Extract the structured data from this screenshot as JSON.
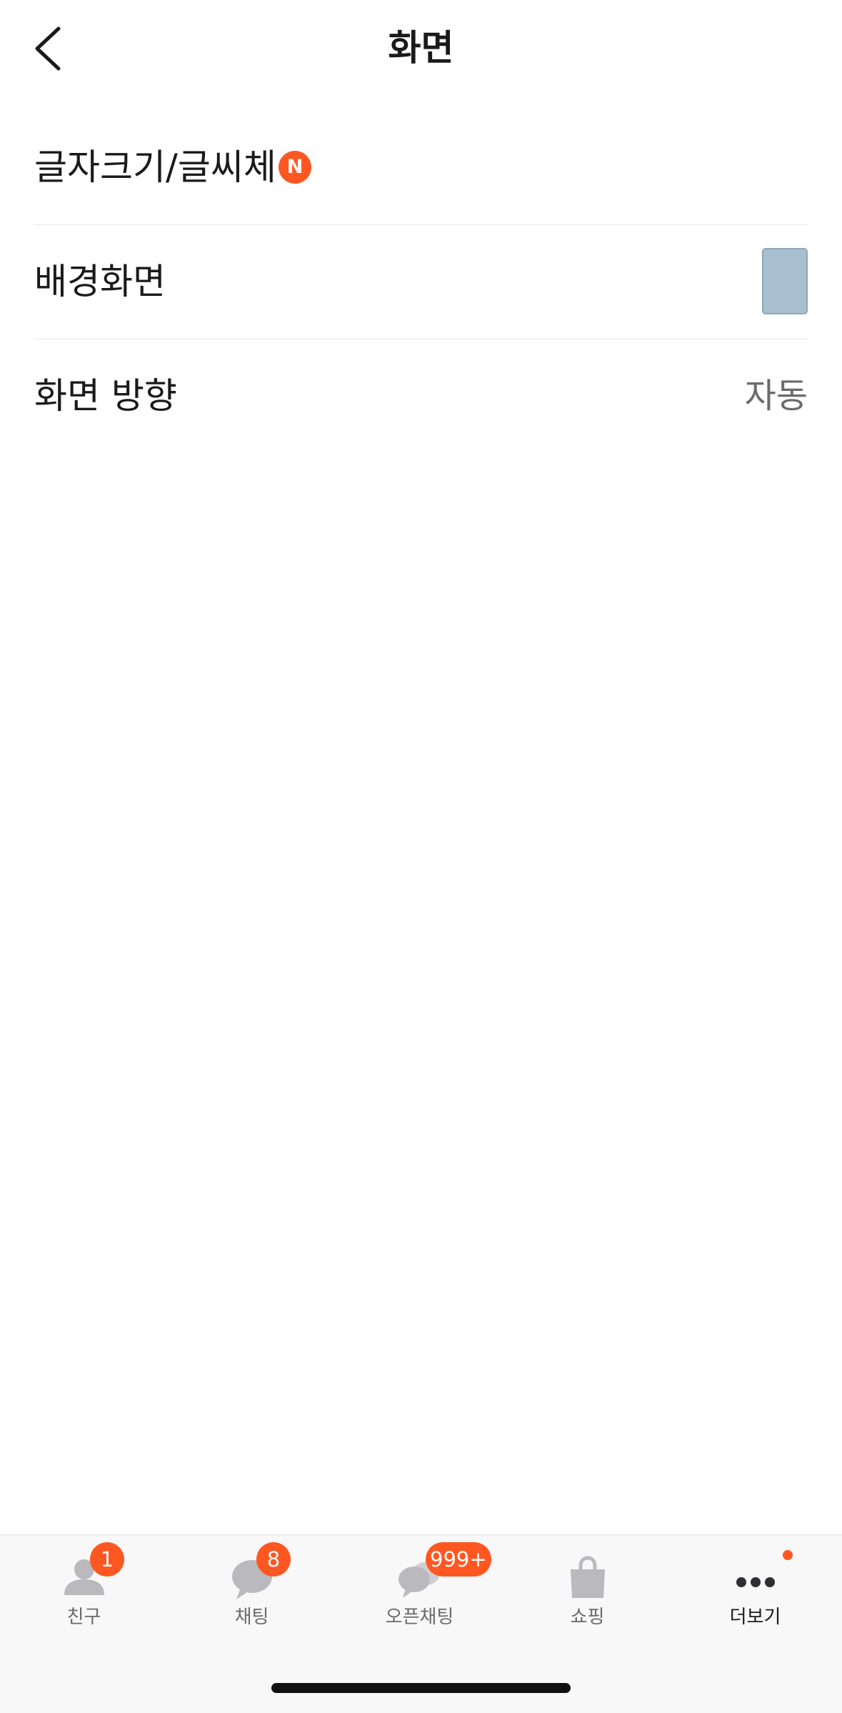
{
  "header": {
    "title": "화면",
    "back_icon": "chevron-left-icon"
  },
  "settings": {
    "font_size_label": "글자크기/글씨체",
    "font_size_badge": "N",
    "wallpaper_label": "배경화면",
    "wallpaper_color": "#a8bfcf",
    "orientation_label": "화면 방향",
    "orientation_value": "자동"
  },
  "tabbar": {
    "friends": {
      "label": "친구",
      "badge": "1",
      "icon": "person-icon"
    },
    "chats": {
      "label": "채팅",
      "badge": "8",
      "icon": "chat-bubble-icon"
    },
    "openchat": {
      "label": "오픈채팅",
      "badge": "999+",
      "icon": "open-chat-icon"
    },
    "shopping": {
      "label": "쇼핑",
      "icon": "shopping-bag-icon"
    },
    "more": {
      "label": "더보기",
      "icon": "more-dots-icon",
      "active": true,
      "has_dot": true
    }
  },
  "colors": {
    "accent": "#ff5722",
    "tab_icon_inactive": "#b9b9be",
    "tab_icon_active": "#2d2f33"
  }
}
